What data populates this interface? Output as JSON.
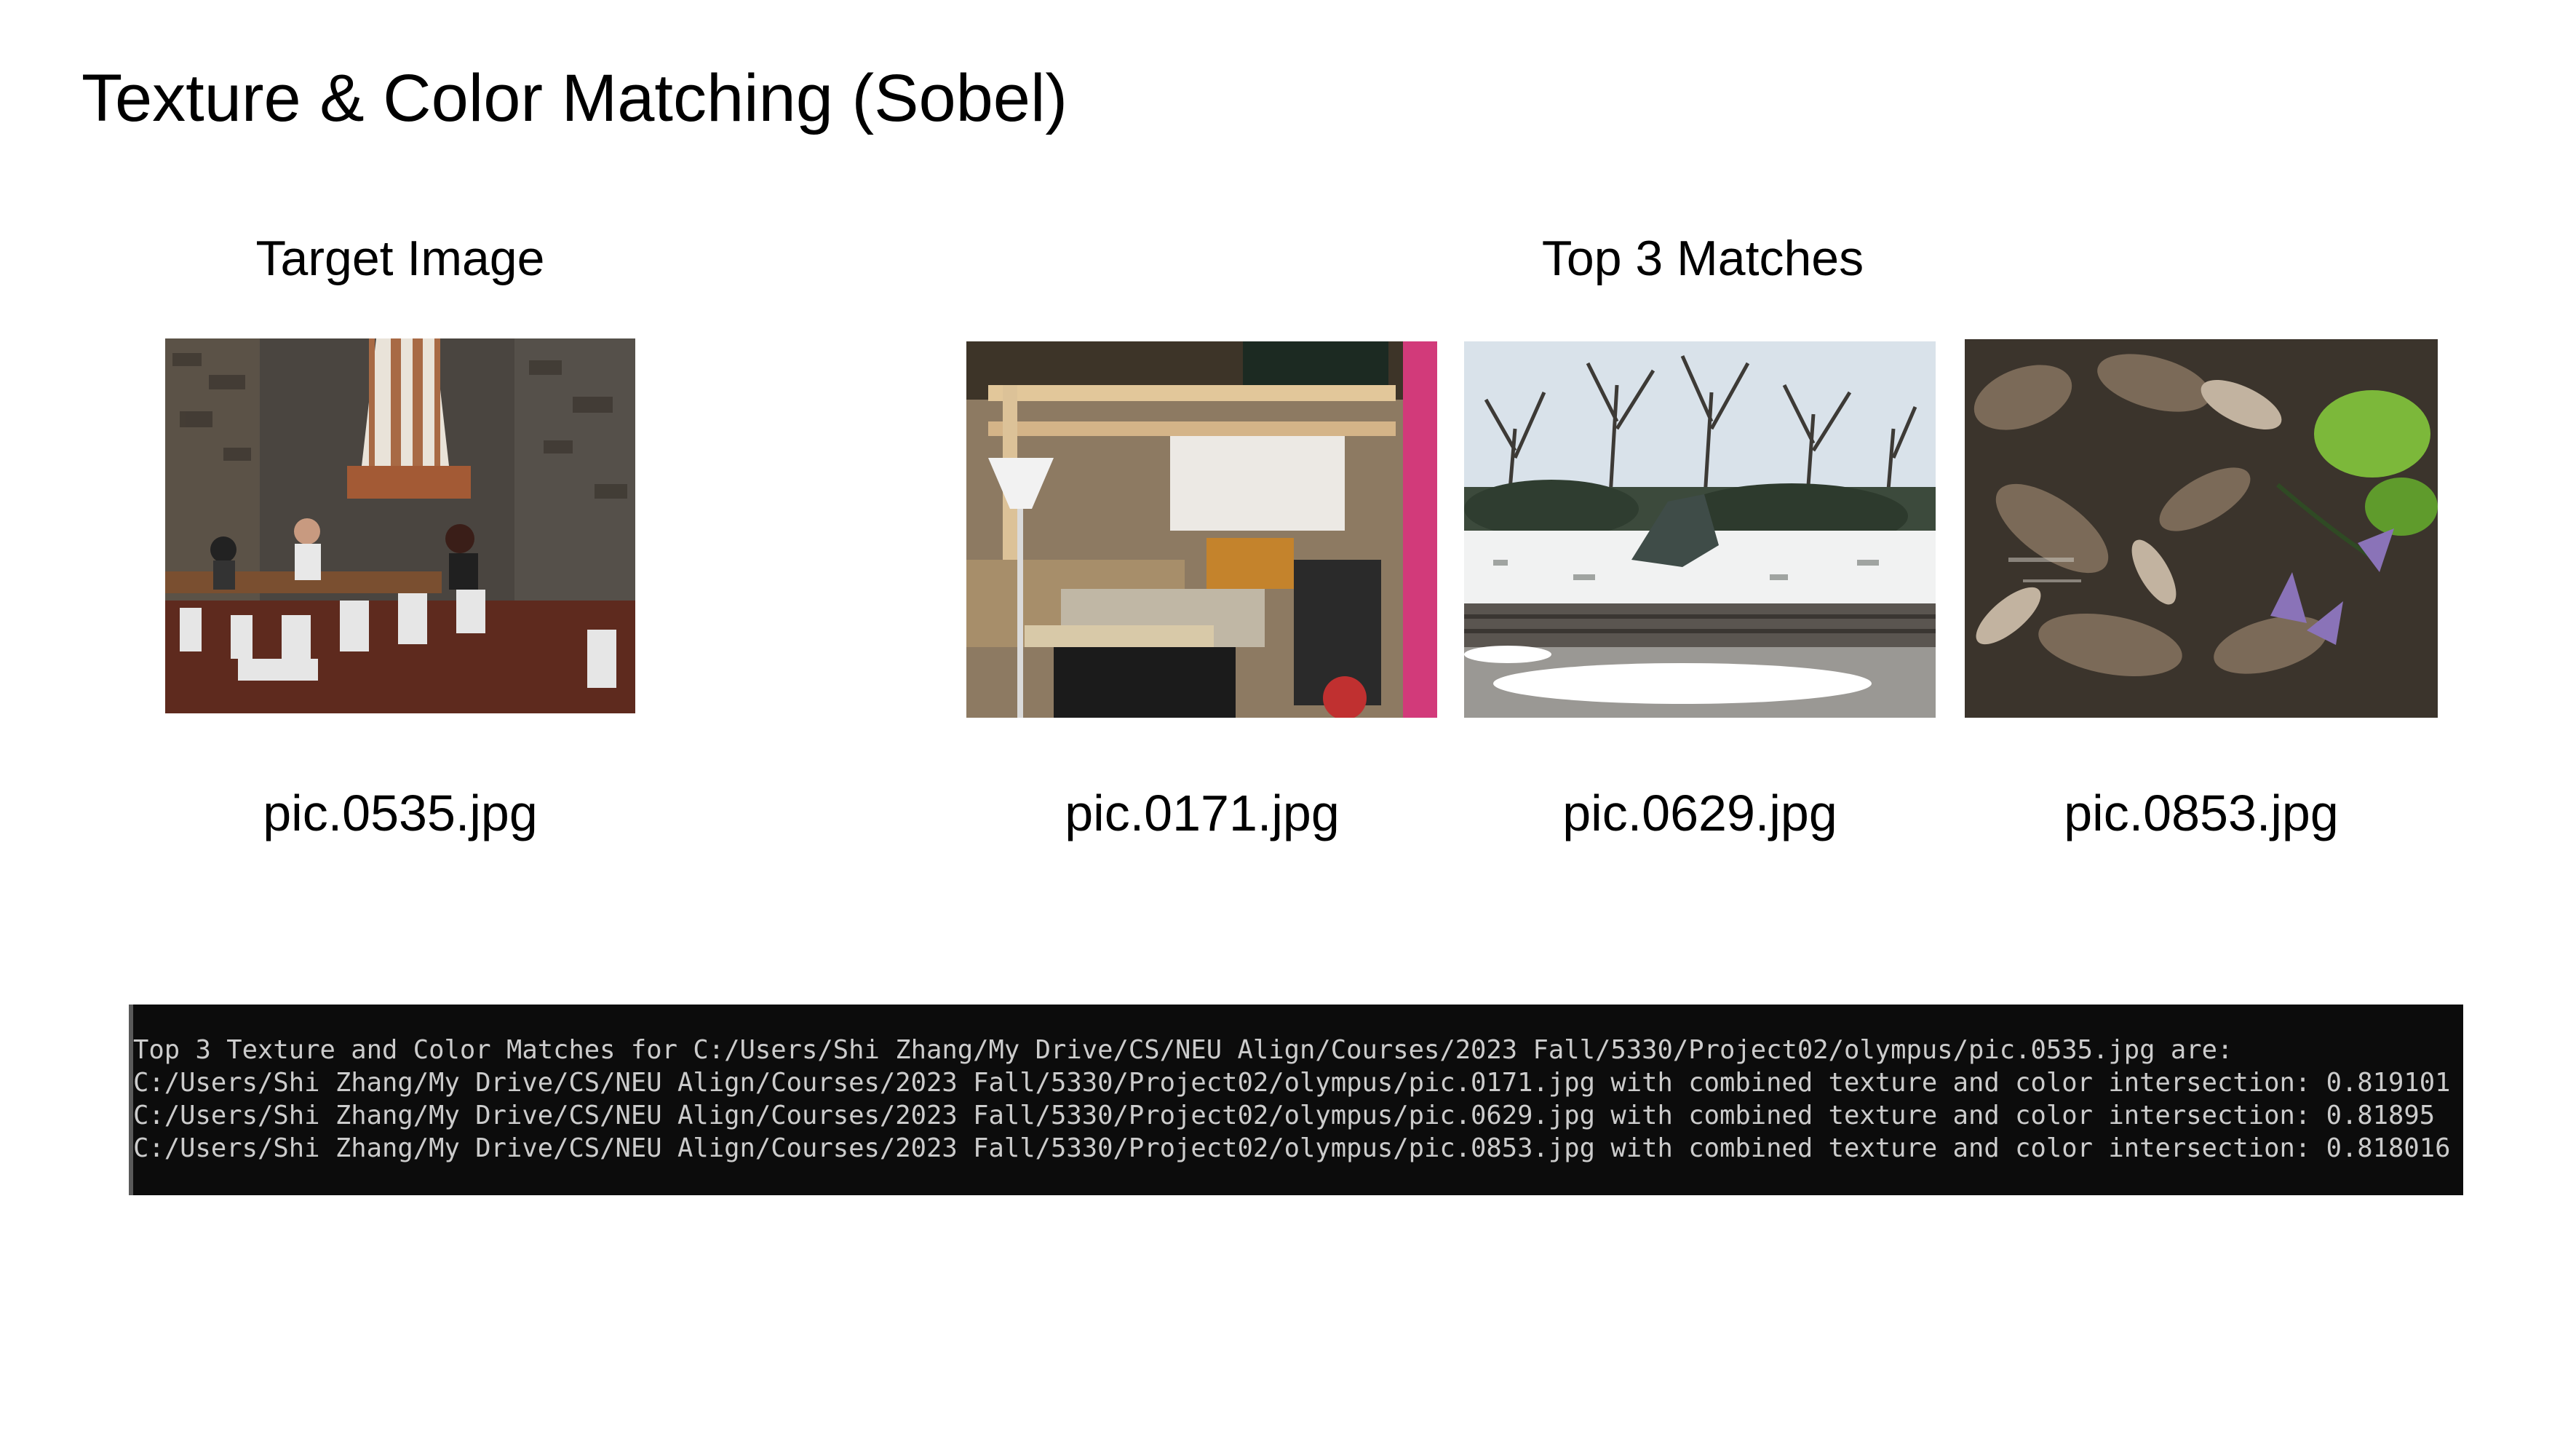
{
  "slide": {
    "title": "Texture & Color Matching (Sobel)",
    "target_heading": "Target Image",
    "matches_heading": "Top 3 Matches"
  },
  "target": {
    "filename": "pic.0535.jpg",
    "description": "Dining hall with stone fireplace and people seated at tables"
  },
  "matches": [
    {
      "filename": "pic.0171.jpg",
      "description": "Cluttered workshop with wooden loft shelving and floor lamp"
    },
    {
      "filename": "pic.0629.jpg",
      "description": "Snowy garden with bare trees and dark sculpture"
    },
    {
      "filename": "pic.0853.jpg",
      "description": "Dry leaves with green plant and purple flowers"
    }
  ],
  "terminal": {
    "lines": [
      "Top 3 Texture and Color Matches for C:/Users/Shi Zhang/My Drive/CS/NEU Align/Courses/2023 Fall/5330/Project02/olympus/pic.0535.jpg are:",
      "C:/Users/Shi Zhang/My Drive/CS/NEU Align/Courses/2023 Fall/5330/Project02/olympus/pic.0171.jpg with combined texture and color intersection: 0.819101",
      "C:/Users/Shi Zhang/My Drive/CS/NEU Align/Courses/2023 Fall/5330/Project02/olympus/pic.0629.jpg with combined texture and color intersection: 0.81895",
      "C:/Users/Shi Zhang/My Drive/CS/NEU Align/Courses/2023 Fall/5330/Project02/olympus/pic.0853.jpg with combined texture and color intersection: 0.818016"
    ]
  }
}
